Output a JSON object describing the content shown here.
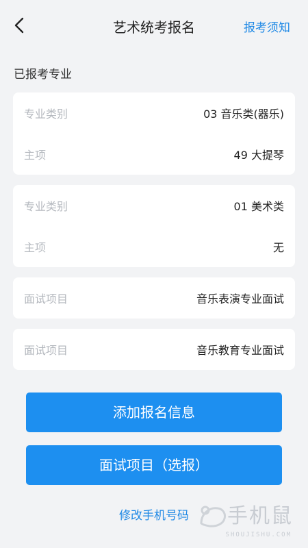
{
  "header": {
    "title": "艺术统考报名",
    "notice_link": "报考须知"
  },
  "section_label": "已报考专业",
  "cards": [
    {
      "rows": [
        {
          "label": "专业类别",
          "value": "03 音乐类(器乐)"
        },
        {
          "label": "主项",
          "value": "49 大提琴"
        }
      ]
    },
    {
      "rows": [
        {
          "label": "专业类别",
          "value": "01 美术类"
        },
        {
          "label": "主项",
          "value": "无"
        }
      ]
    },
    {
      "rows": [
        {
          "label": "面试项目",
          "value": "音乐表演专业面试"
        }
      ]
    },
    {
      "rows": [
        {
          "label": "面试项目",
          "value": "音乐教育专业面试"
        }
      ]
    }
  ],
  "buttons": {
    "add_registration": "添加报名信息",
    "interview_optional": "面试项目（选报）"
  },
  "bottom_link": "修改手机号码",
  "watermark": {
    "brand": "手机鼠",
    "domain": "SHOUJISHU.COM"
  },
  "icons": {
    "back": "chevron-left-icon",
    "watermark_logo": "mouse-logo-icon"
  }
}
